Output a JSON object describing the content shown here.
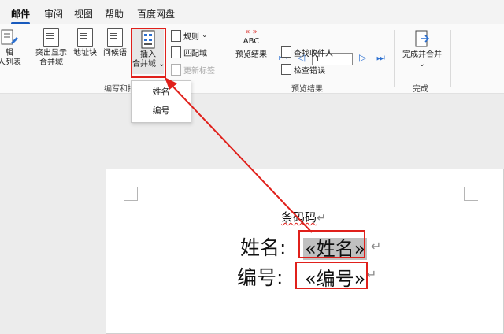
{
  "tabs": [
    {
      "label": "邮件",
      "active": true
    },
    {
      "label": "审阅"
    },
    {
      "label": "视图"
    },
    {
      "label": "帮助"
    },
    {
      "label": "百度网盘"
    }
  ],
  "ribbon": {
    "edit_list": {
      "line1": "辑",
      "line2": "人列表"
    },
    "highlight_fields": {
      "line1": "突出显示",
      "line2": "合并域"
    },
    "address_block": "地址块",
    "greeting_line": "问候语",
    "insert_field": {
      "line1": "插入",
      "line2": "合并域"
    },
    "rules": "规则",
    "match_fields": "匹配域",
    "update_labels": "更新标签",
    "group_write": "编写和插",
    "preview_results": {
      "abc": "ABC",
      "label": "预览结果"
    },
    "record_number": "1",
    "find_recipient": "查找收件人",
    "check_errors": "检查错误",
    "group_preview": "预览结果",
    "finish_merge": "完成并合并",
    "group_finish": "完成"
  },
  "dropdown": {
    "items": [
      "姓名",
      "编号"
    ]
  },
  "document": {
    "barcode_label": "条码码",
    "name_label": "姓名:",
    "name_field": "«姓名»",
    "number_label": "编号:",
    "number_field": "«编号»",
    "para_mark": "↵"
  },
  "colors": {
    "annotation": "#e0201b",
    "accent": "#185abd",
    "field_shading": "#c0c0c0"
  }
}
